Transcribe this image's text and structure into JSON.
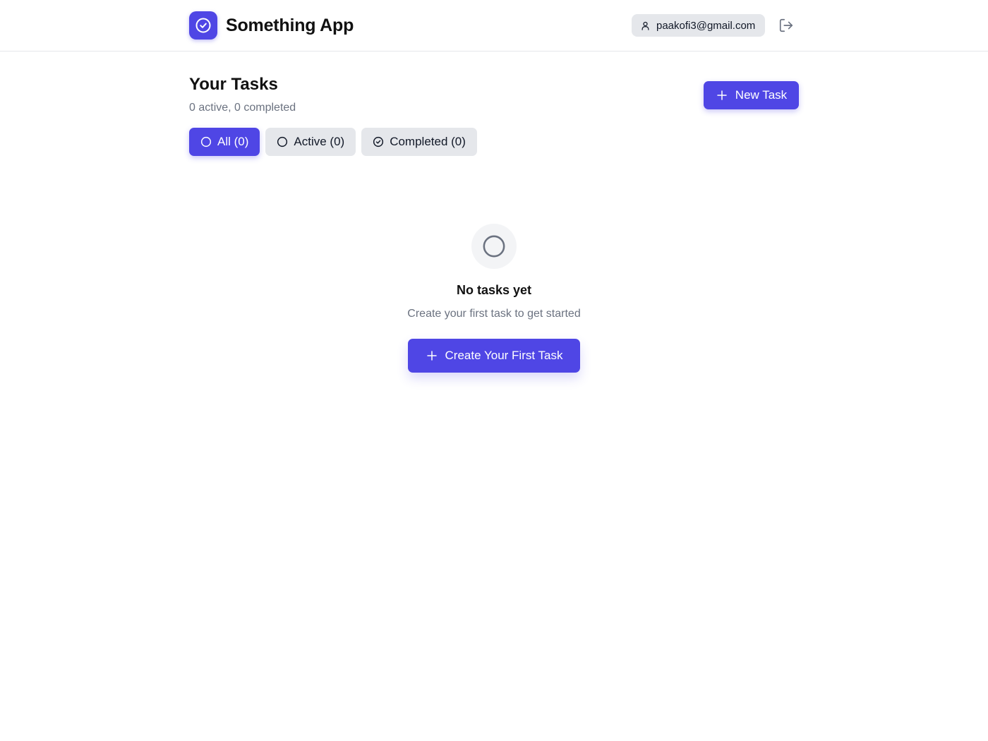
{
  "app": {
    "title": "Something App",
    "logo_icon": "check-circle-icon",
    "accent_color": "#4f46e5"
  },
  "header": {
    "user_email": "paakofi3@gmail.com",
    "user_icon": "user-icon",
    "logout_icon": "logout-icon"
  },
  "main": {
    "title": "Your Tasks",
    "summary": "0 active, 0 completed",
    "new_task_label": "New Task",
    "filters": [
      {
        "label": "All (0)",
        "icon": "circle-icon",
        "selected": true
      },
      {
        "label": "Active (0)",
        "icon": "circle-icon",
        "selected": false
      },
      {
        "label": "Completed (0)",
        "icon": "check-circle-icon",
        "selected": false
      }
    ]
  },
  "empty_state": {
    "icon": "circle-icon",
    "title": "No tasks yet",
    "text": "Create your first task to get started",
    "button_label": "Create Your First Task"
  }
}
